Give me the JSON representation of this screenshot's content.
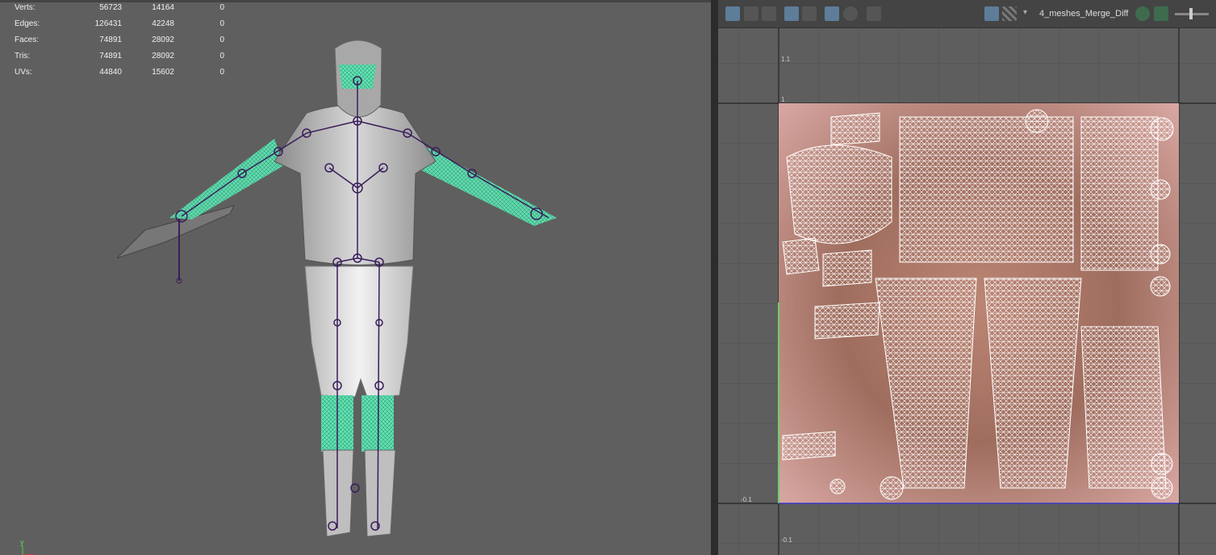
{
  "viewport3d": {
    "stats": [
      {
        "label": "Verts:",
        "v1": "56723",
        "v2": "14164",
        "v3": "0"
      },
      {
        "label": "Edges:",
        "v1": "126431",
        "v2": "42248",
        "v3": "0"
      },
      {
        "label": "Faces:",
        "v1": "74891",
        "v2": "28092",
        "v3": "0"
      },
      {
        "label": "Tris:",
        "v1": "74891",
        "v2": "28092",
        "v3": "0"
      },
      {
        "label": "UVs:",
        "v1": "44840",
        "v2": "15602",
        "v3": "0"
      }
    ],
    "axis_label": "y"
  },
  "uv_editor": {
    "texture_name": "4_meshes_Merge_Diff",
    "ticks": {
      "t1_1": "1.1",
      "t1": "1",
      "tm01_left": "-0.1",
      "tm01_bottom": "-0.1"
    }
  },
  "colors": {
    "viewport_bg": "#5f5f5f",
    "uv_bg": "#5e5e5e",
    "joint": "#3a1d5a",
    "selection_green": "#5fe0b0",
    "wire": "#ffffff",
    "accent": "#5d7d9a"
  }
}
